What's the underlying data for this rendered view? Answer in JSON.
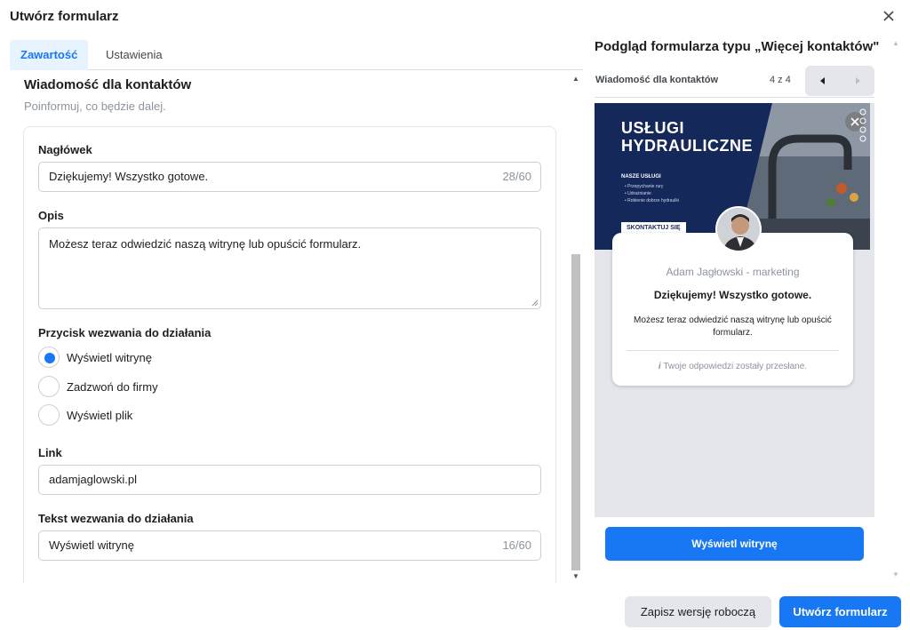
{
  "dialog": {
    "title": "Utwórz formularz",
    "close_icon": "close-icon"
  },
  "tabs": [
    {
      "label": "Zawartość",
      "active": true
    },
    {
      "label": "Ustawienia",
      "active": false
    }
  ],
  "section": {
    "title": "Wiadomość dla kontaktów",
    "subtitle": "Poinformuj, co będzie dalej."
  },
  "form": {
    "headline": {
      "label": "Nagłówek",
      "value": "Dziękujemy! Wszystko gotowe.",
      "counter": "28/60"
    },
    "description": {
      "label": "Opis",
      "value": "Możesz teraz odwiedzić naszą witrynę lub opuścić formularz."
    },
    "cta_type": {
      "label": "Przycisk wezwania do działania",
      "options": [
        {
          "label": "Wyświetl witrynę",
          "checked": true
        },
        {
          "label": "Zadzwoń do firmy",
          "checked": false
        },
        {
          "label": "Wyświetl plik",
          "checked": false
        }
      ]
    },
    "link": {
      "label": "Link",
      "value": "adamjaglowski.pl"
    },
    "cta_text": {
      "label": "Tekst wezwania do działania",
      "value": "Wyświetl witrynę",
      "counter": "16/60"
    }
  },
  "preview": {
    "title": "Podgląd formularza typu „Więcej kontaktów\"",
    "step_label": "Wiadomość dla kontaktów",
    "step_count": "4 z 4",
    "banner": {
      "title_line1": "USŁUGI",
      "title_line2": "HYDRAULICZNE",
      "sub": "NASZE USŁUGI",
      "items": [
        "• Przepychanie rury",
        "• Udrażnianie",
        "• Robienie dobrze hydraulki"
      ],
      "cta": "SKONTAKTUJ SIĘ"
    },
    "card": {
      "company": "Adam Jagłowski - marketing",
      "heading": "Dziękujemy! Wszystko gotowe.",
      "description": "Możesz teraz odwiedzić naszą witrynę lub opuścić formularz.",
      "note": "Twoje odpowiedzi zostały przesłane."
    },
    "cta_button": "Wyświetl witrynę"
  },
  "footer": {
    "draft_button": "Zapisz wersję roboczą",
    "create_button": "Utwórz formularz"
  },
  "colors": {
    "accent": "#1877f2",
    "banner": "#14285a",
    "preview_bg": "#e4e6eb"
  }
}
